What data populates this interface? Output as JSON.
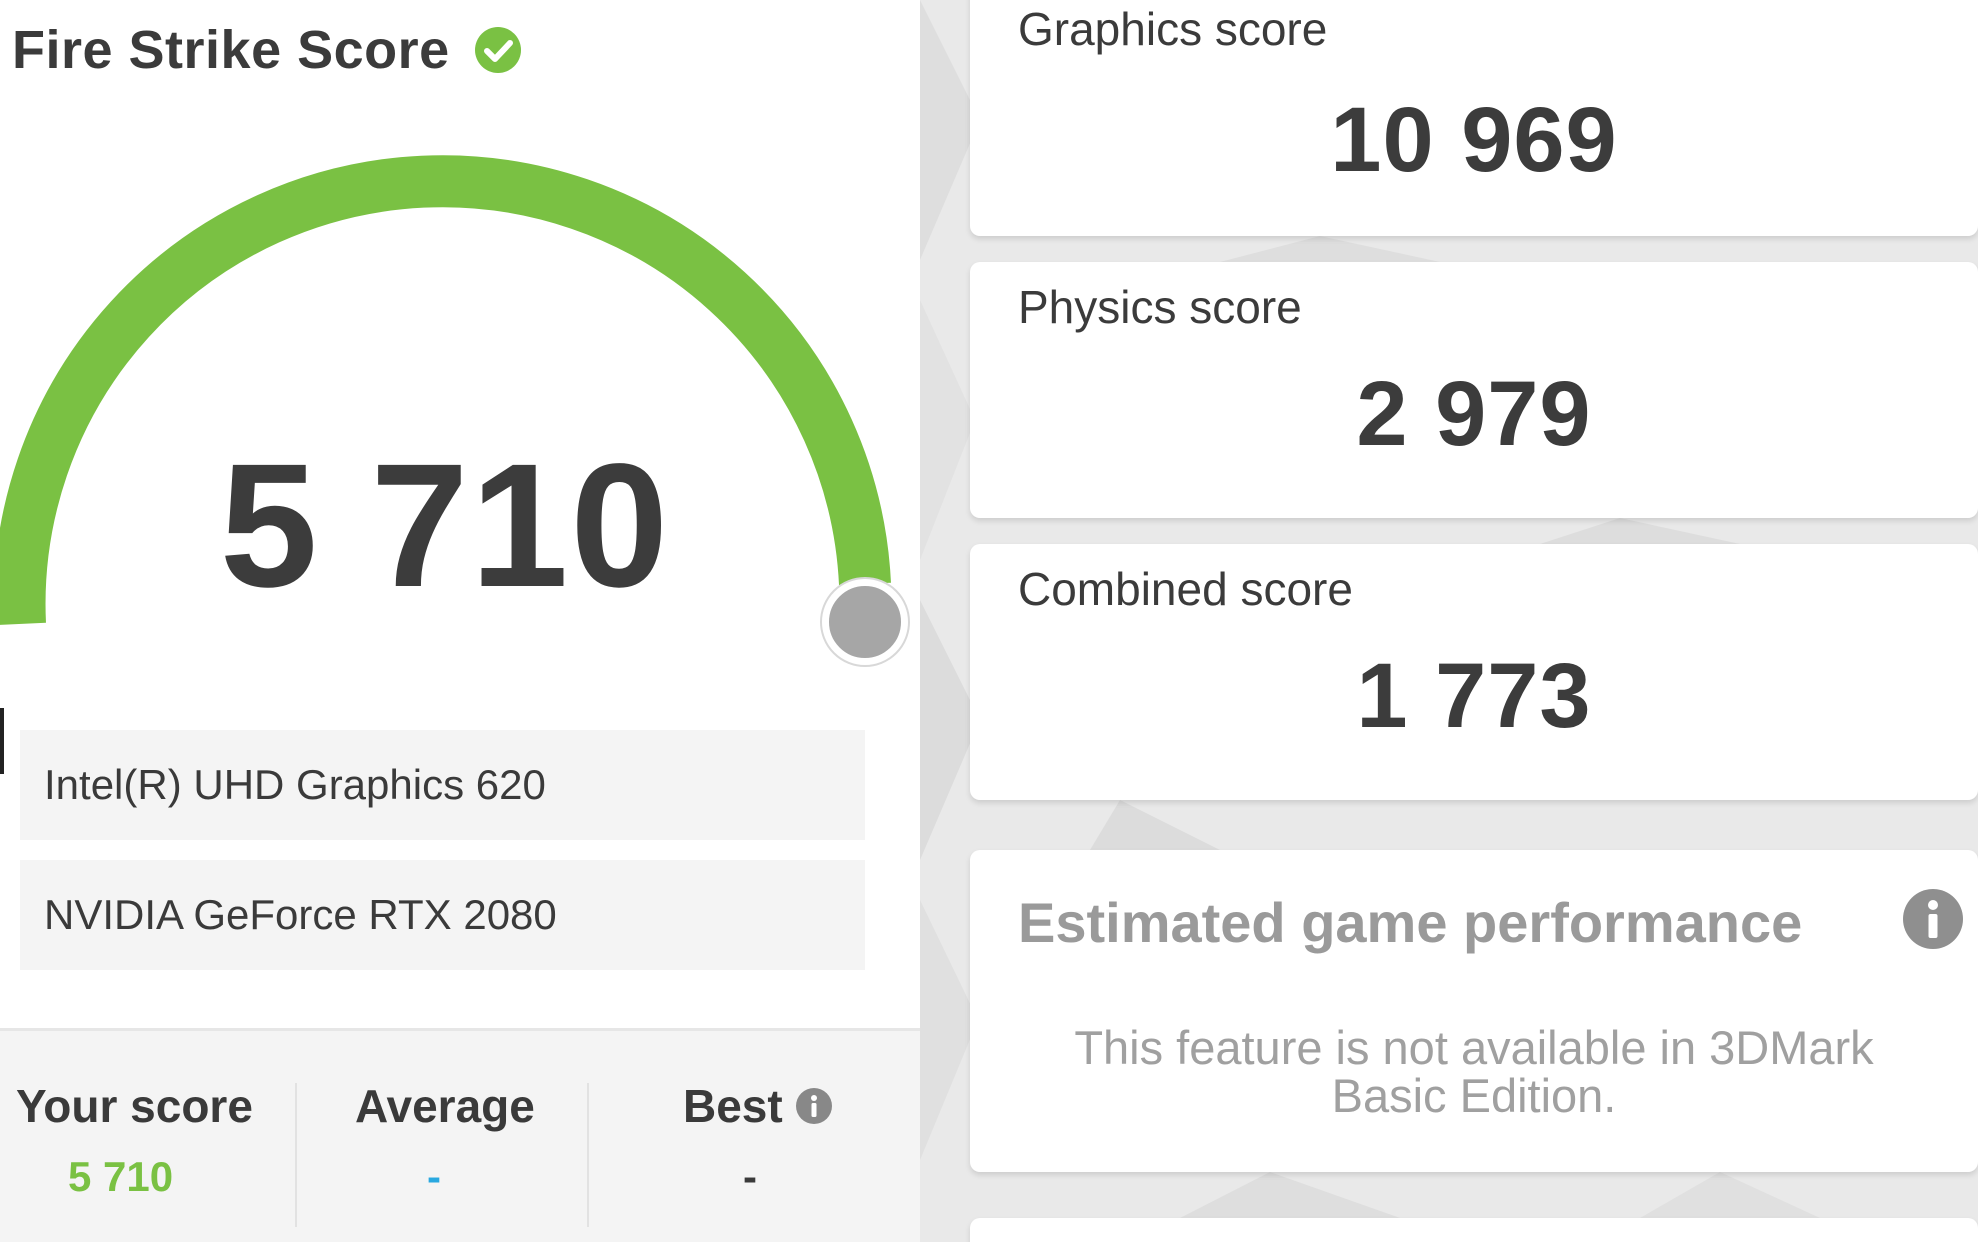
{
  "header": {
    "title": "Fire Strike Score",
    "status_icon": "check-circle-icon",
    "accent_color": "#7ac143"
  },
  "gauge": {
    "score": "5 710",
    "track_color": "#7ac143",
    "handle_color": "#a6a6a6"
  },
  "devices": [
    {
      "name": "Intel(R) UHD Graphics 620"
    },
    {
      "name": "NVIDIA GeForce RTX 2080"
    }
  ],
  "comparison": {
    "your_score": {
      "label": "Your score",
      "value": "5 710",
      "color": "#7ac143"
    },
    "average": {
      "label": "Average",
      "value": "-",
      "color": "#29a8e0"
    },
    "best": {
      "label": "Best",
      "value": "-",
      "icon": "info-icon"
    }
  },
  "subscores": [
    {
      "label": "Graphics score",
      "value": "10 969"
    },
    {
      "label": "Physics score",
      "value": "2 979"
    },
    {
      "label": "Combined score",
      "value": "1 773"
    }
  ],
  "game_performance": {
    "title": "Estimated game performance",
    "icon": "info-icon",
    "note": "This feature is not available in 3DMark Basic Edition."
  }
}
